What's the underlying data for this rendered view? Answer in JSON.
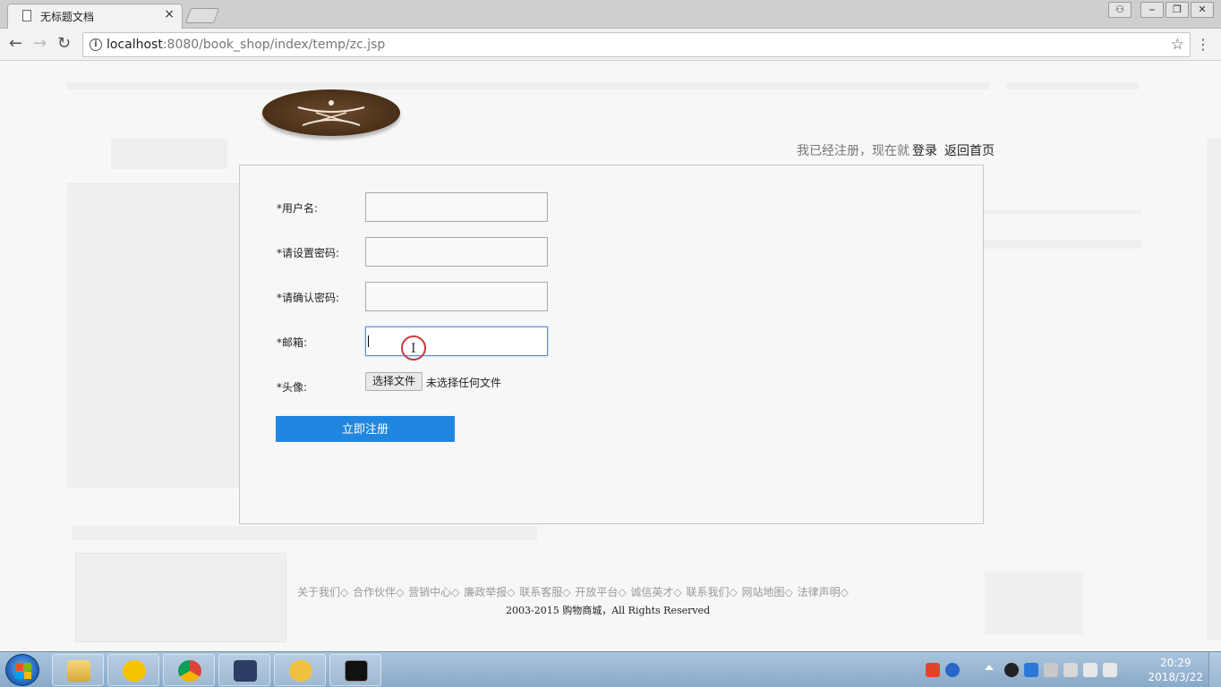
{
  "browser": {
    "tab_title": "无标题文档",
    "tab_close": "×",
    "url_host": "localhost",
    "url_rest": ":8080/book_shop/index/temp/zc.jsp",
    "window_buttons": [
      "⎯",
      "❐",
      "✕"
    ]
  },
  "header": {
    "prompt_text": "我已经注册，现在就",
    "login_link": "登录",
    "home_link": "返回首页"
  },
  "form": {
    "username_label": "*用户名:",
    "password_label": "*请设置密码:",
    "confirm_label": "*请确认密码:",
    "email_label": "*邮箱:",
    "avatar_label": "*头像:",
    "username_value": "",
    "password_value": "",
    "confirm_value": "",
    "email_value": "",
    "file_button": "选择文件",
    "file_status": "未选择任何文件",
    "submit_label": "立即注册"
  },
  "footer": {
    "links": [
      "关于我们◇",
      "合作伙伴◇",
      "营销中心◇",
      "廉政举报◇",
      "联系客服◇",
      "开放平台◇",
      "诚信英才◇",
      "联系我们◇",
      "网站地图◇",
      "法律声明◇"
    ],
    "copyright": "2003-2015 购物商城，All Rights Reserved"
  },
  "taskbar": {
    "time": "20:29",
    "date": "2018/3/22"
  }
}
